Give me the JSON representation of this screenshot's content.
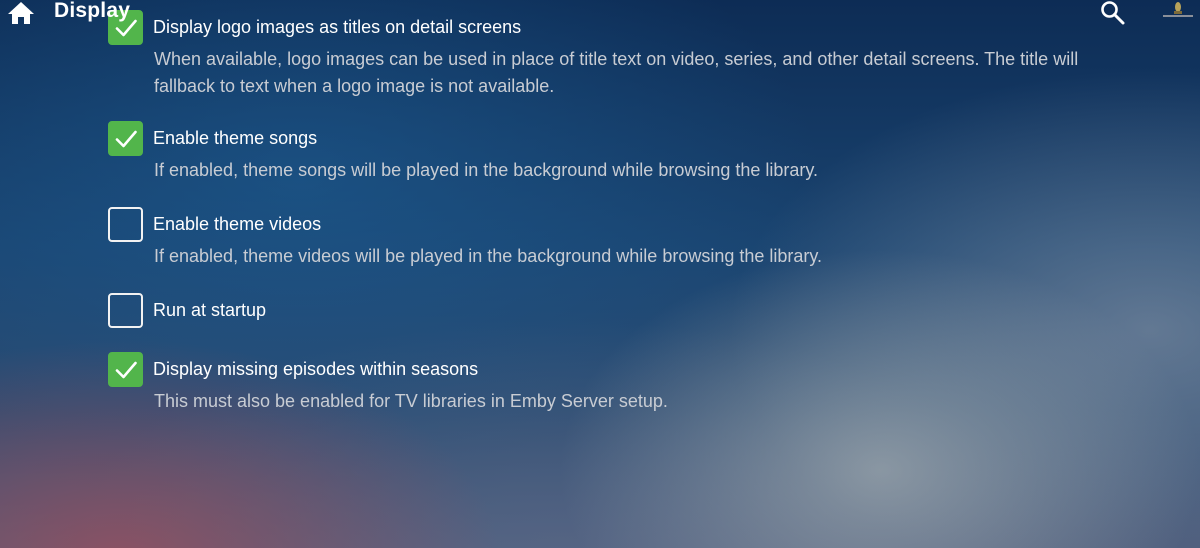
{
  "header": {
    "title": "Display",
    "home_icon": "home-icon",
    "search_icon": "search-icon",
    "avatar_icon": "user-avatar"
  },
  "colors": {
    "checkbox_checked": "#52b54b",
    "checkbox_unchecked_border": "#f2f2f2",
    "description_text": "#c8ccd3"
  },
  "settings": [
    {
      "label": "Display logo images as titles on detail screens",
      "description": "When available, logo images can be used in place of title text on video, series, and other detail screens. The title will fallback to text when a logo image is not available.",
      "checked": true
    },
    {
      "label": "Enable theme songs",
      "description": "If enabled, theme songs will be played in the background while browsing the library.",
      "checked": true
    },
    {
      "label": "Enable theme videos",
      "description": "If enabled, theme videos will be played in the background while browsing the library.",
      "checked": false
    },
    {
      "label": "Run at startup",
      "description": "",
      "checked": false
    },
    {
      "label": "Display missing episodes within seasons",
      "description": "This must also be enabled for TV libraries in Emby Server setup.",
      "checked": true
    }
  ]
}
